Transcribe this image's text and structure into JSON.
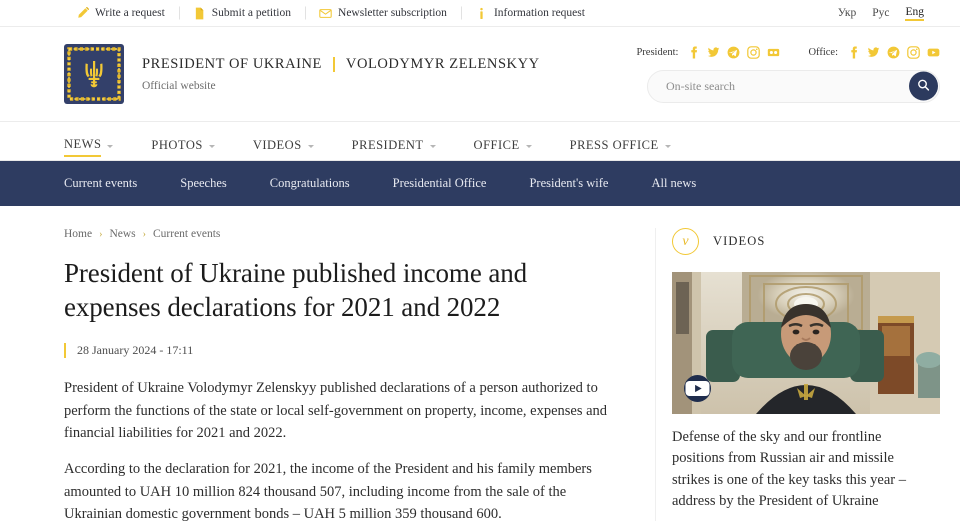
{
  "topbar": {
    "links": [
      {
        "icon": "pencil-icon",
        "label": "Write a request"
      },
      {
        "icon": "document-icon",
        "label": "Submit a petition"
      },
      {
        "icon": "envelope-icon",
        "label": "Newsletter subscription"
      },
      {
        "icon": "info-icon",
        "label": "Information request"
      }
    ],
    "languages": [
      {
        "label": "Укр",
        "active": false
      },
      {
        "label": "Рус",
        "active": false
      },
      {
        "label": "Eng",
        "active": true
      }
    ]
  },
  "header": {
    "logo": "ukraine-coat-of-arms",
    "brand_primary": "PRESIDENT OF UKRAINE",
    "brand_secondary": "VOLODYMYR ZELENSKYY",
    "brand_sub": "Official website",
    "social": [
      {
        "label": "President:",
        "icons": [
          "facebook-icon",
          "twitter-icon",
          "telegram-icon",
          "instagram-icon",
          "flickr-icon"
        ]
      },
      {
        "label": "Office:",
        "icons": [
          "facebook-icon",
          "twitter-icon",
          "telegram-icon",
          "instagram-icon",
          "youtube-icon"
        ]
      }
    ],
    "search": {
      "placeholder": "On-site search",
      "value": "",
      "button_icon": "search-icon"
    }
  },
  "mainnav": [
    {
      "label": "NEWS",
      "active": true,
      "caret": true
    },
    {
      "label": "PHOTOS",
      "active": false,
      "caret": true
    },
    {
      "label": "VIDEOS",
      "active": false,
      "caret": true
    },
    {
      "label": "PRESIDENT",
      "active": false,
      "caret": true
    },
    {
      "label": "OFFICE",
      "active": false,
      "caret": true
    },
    {
      "label": "PRESS OFFICE",
      "active": false,
      "caret": true
    }
  ],
  "subnav": [
    {
      "label": "Current events"
    },
    {
      "label": "Speeches"
    },
    {
      "label": "Congratulations"
    },
    {
      "label": "Presidential Office"
    },
    {
      "label": "President's wife"
    },
    {
      "label": "All news"
    }
  ],
  "breadcrumb": [
    {
      "label": "Home"
    },
    {
      "label": "News"
    },
    {
      "label": "Current events"
    }
  ],
  "article": {
    "title": "President of Ukraine published income and expenses declarations for 2021 and 2022",
    "date": "28 January 2024 - 17:11",
    "paragraphs": [
      "President of Ukraine Volodymyr Zelenskyy published declarations of a person authorized to perform the functions of the state or local self-government on property, income, expenses and financial liabilities for 2021 and 2022.",
      "According to the declaration for 2021, the income of the President and his family members amounted to UAH 10 million 824 thousand 507, including income from the sale of the Ukrainian domestic government bonds – UAH 5 million 359 thousand 600."
    ]
  },
  "sidebar": {
    "badge_glyph": "v",
    "title": "VIDEOS",
    "video": {
      "thumbnail_alt": "President Zelenskyy addressing camera in ornate hall",
      "play_icon": "youtube-play-icon",
      "caption": "Defense of the sky and our frontline positions from Russian air and missile strikes is one of the key tasks this year – address by the President of Ukraine"
    }
  },
  "colors": {
    "accent_yellow": "#f2c836",
    "navy": "#2e3c61",
    "text": "#2d2d2d",
    "muted": "#6a6a6a"
  }
}
